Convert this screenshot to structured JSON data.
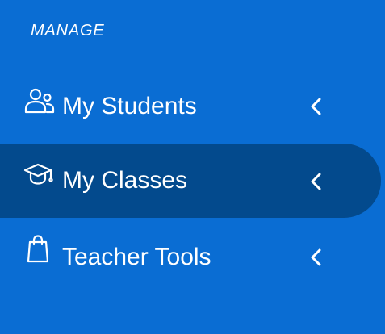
{
  "sidebar": {
    "section_title": "MANAGE",
    "items": [
      {
        "label": "My Students",
        "icon": "users-icon",
        "active": false
      },
      {
        "label": "My Classes",
        "icon": "graduation-cap-icon",
        "active": true
      },
      {
        "label": "Teacher Tools",
        "icon": "shopping-bag-icon",
        "active": false
      }
    ]
  },
  "colors": {
    "background": "#0a6dd3",
    "active_background": "#034a8d",
    "text": "#ffffff"
  }
}
